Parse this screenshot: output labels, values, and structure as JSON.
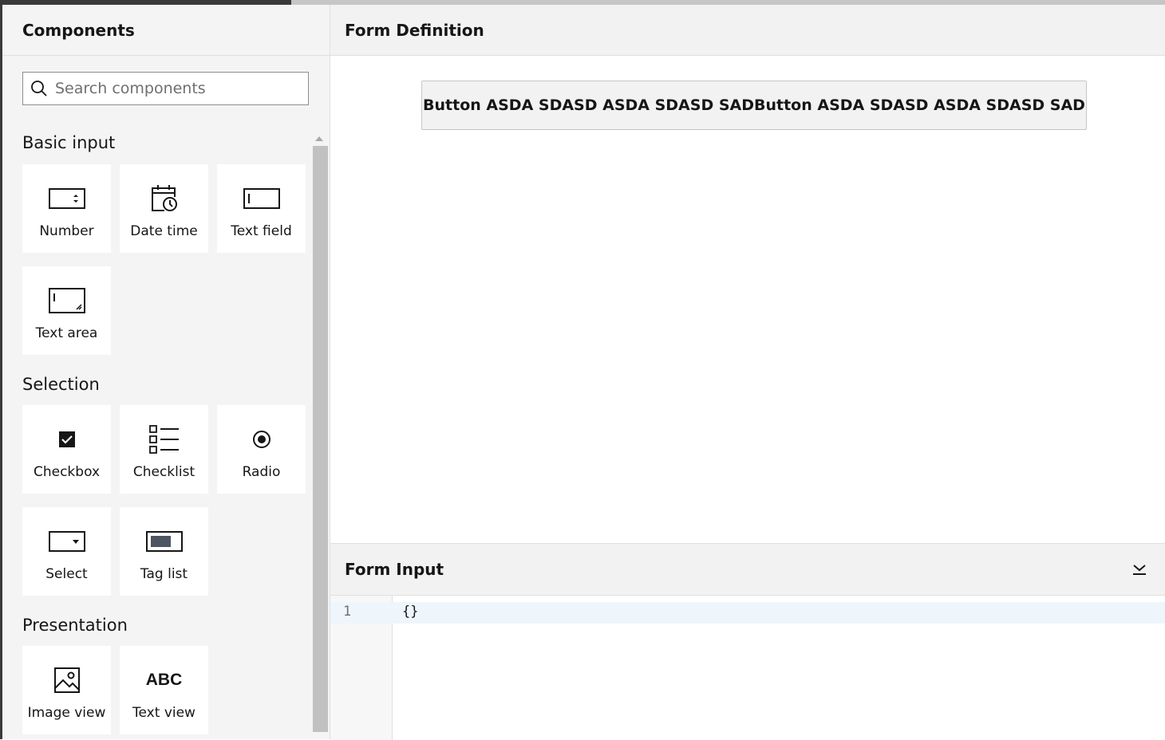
{
  "progress": {
    "fraction": 0.25
  },
  "palette": {
    "title": "Components",
    "search_placeholder": "Search components",
    "groups": [
      {
        "title": "Basic input",
        "items": [
          {
            "label": "Number",
            "icon": "number-icon"
          },
          {
            "label": "Date time",
            "icon": "datetime-icon"
          },
          {
            "label": "Text field",
            "icon": "textfield-icon"
          },
          {
            "label": "Text area",
            "icon": "textarea-icon"
          }
        ]
      },
      {
        "title": "Selection",
        "items": [
          {
            "label": "Checkbox",
            "icon": "checkbox-icon"
          },
          {
            "label": "Checklist",
            "icon": "checklist-icon"
          },
          {
            "label": "Radio",
            "icon": "radio-icon"
          },
          {
            "label": "Select",
            "icon": "select-icon"
          },
          {
            "label": "Tag list",
            "icon": "taglist-icon"
          }
        ]
      },
      {
        "title": "Presentation",
        "items": [
          {
            "label": "Image view",
            "icon": "image-icon"
          },
          {
            "label": "Text view",
            "icon": "textview-icon",
            "glyph": "ABC"
          }
        ]
      }
    ]
  },
  "definition": {
    "title": "Form Definition",
    "button_label": "Button ASDA SDASD ASDA SDASD SADButton ASDA SDASD ASDA SDASD SAD"
  },
  "form_input": {
    "title": "Form Input",
    "lines": [
      {
        "number": "1",
        "code": "{}"
      }
    ]
  }
}
